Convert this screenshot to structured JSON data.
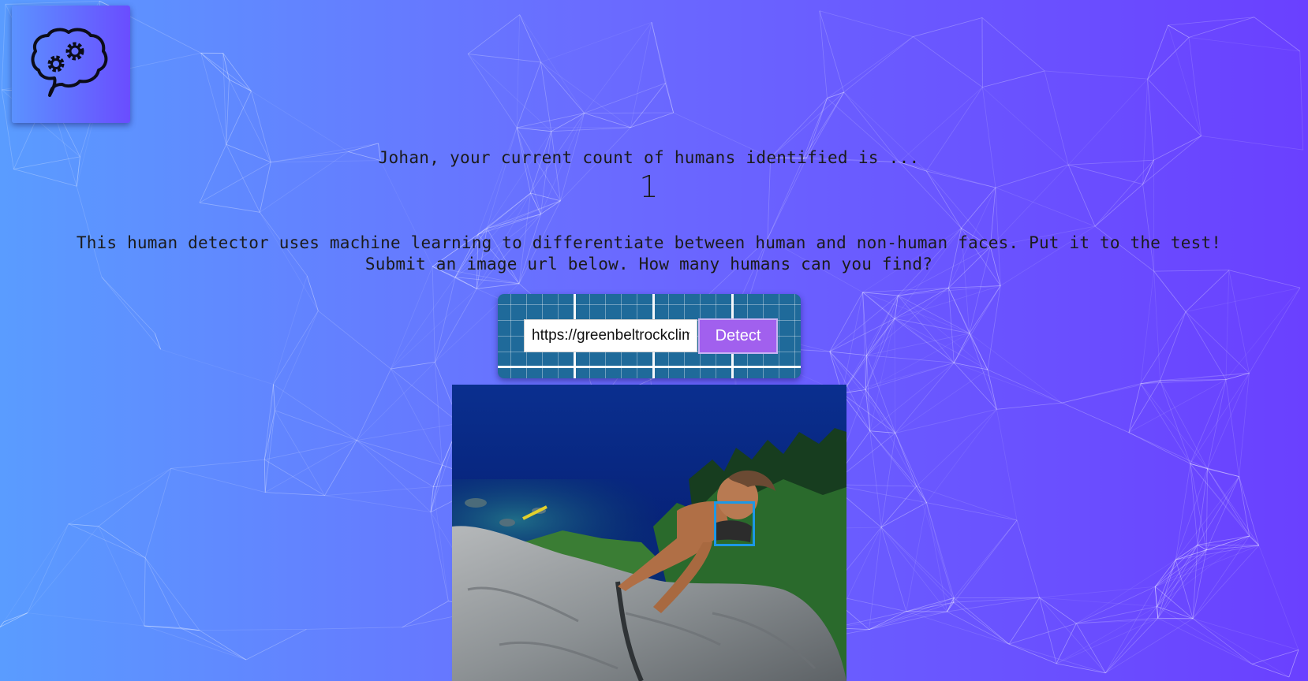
{
  "app": {
    "logo_icon": "brain-gears-icon"
  },
  "counter": {
    "greeting": "Johan, your current count of humans identified is ...",
    "count": "1"
  },
  "description": {
    "line1": "This human detector uses machine learning to differentiate between human and non-human faces. Put it to the test!",
    "line2": "Submit an image url below. How many humans can you find?"
  },
  "form": {
    "url_value": "https://greenbeltrockclimbing.com/",
    "detect_label": "Detect"
  },
  "result": {
    "image_subject": "rock climber on granite slab above lake",
    "faces_detected": 1
  },
  "colors": {
    "background_start": "#5a9cff",
    "background_end": "#6a40ff",
    "button": "#a160ee",
    "face_box": "#1d98e6",
    "panel": "#1f6a9a"
  }
}
